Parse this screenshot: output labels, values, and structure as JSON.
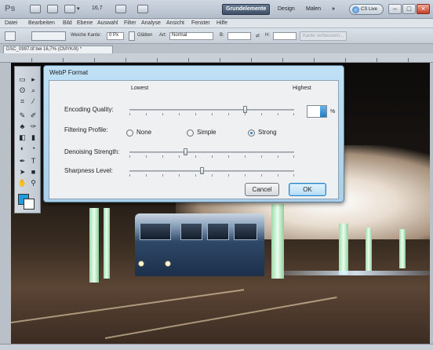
{
  "app": {
    "logo": "Ps",
    "zoom_label": "16,7",
    "workspaces": [
      "Grundelemente",
      "Design",
      "Malen"
    ],
    "more": "»",
    "cs_live": "CS Live"
  },
  "menu": [
    "Datei",
    "Bearbeiten",
    "Bild",
    "Ebene",
    "Auswahl",
    "Filter",
    "Analyse",
    "Ansicht",
    "Fenster",
    "Hilfe"
  ],
  "options": {
    "feather_label": "Weiche Kante:",
    "feather_value": "0 Px",
    "antialias_label": "Glätten",
    "style_label": "Art:",
    "style_value": "Normal",
    "width_label": "B:",
    "height_label": "H:",
    "refine_button": "Kante verbessern..."
  },
  "document": {
    "tab_label": "DSC_0997.tif bei 16,7% (CMYK/8) *"
  },
  "dialog": {
    "title": "WebP Format",
    "scale_low": "Lowest",
    "scale_high": "Highest",
    "quality_label": "Encoding Quality:",
    "quality_value": "",
    "quality_unit": "%",
    "filter_label": "Filtering Profile:",
    "filter_options": [
      "None",
      "Simple",
      "Strong"
    ],
    "filter_selected": "Strong",
    "denoise_label": "Denoising Strength:",
    "sharpness_label": "Sharpness Level:",
    "cancel_button": "Cancel",
    "ok_button": "OK"
  }
}
